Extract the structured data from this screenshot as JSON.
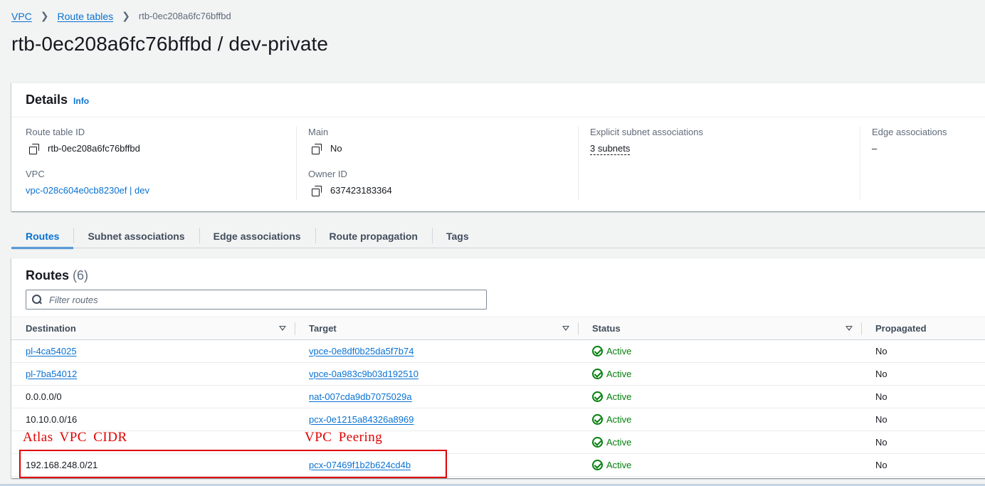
{
  "breadcrumb": {
    "items": [
      "VPC",
      "Route tables"
    ],
    "current": "rtb-0ec208a6fc76bffbd"
  },
  "page_title": "rtb-0ec208a6fc76bffbd / dev-private",
  "details": {
    "heading": "Details",
    "info": "Info",
    "route_table_id_label": "Route table ID",
    "route_table_id": "rtb-0ec208a6fc76bffbd",
    "vpc_label": "VPC",
    "vpc": "vpc-028c604e0cb8230ef | dev",
    "main_label": "Main",
    "main": "No",
    "owner_id_label": "Owner ID",
    "owner_id": "637423183364",
    "explicit_label": "Explicit subnet associations",
    "explicit": "3 subnets",
    "edge_label": "Edge associations",
    "edge": "–"
  },
  "tabs": [
    "Routes",
    "Subnet associations",
    "Edge associations",
    "Route propagation",
    "Tags"
  ],
  "routes": {
    "title": "Routes",
    "count": "(6)",
    "filter_placeholder": "Filter routes",
    "columns": [
      "Destination",
      "Target",
      "Status",
      "Propagated"
    ],
    "rows": [
      {
        "destination": "pl-4ca54025",
        "dest_link": true,
        "target": "vpce-0e8df0b25da5f7b74",
        "status": "Active",
        "propagated": "No"
      },
      {
        "destination": "pl-7ba54012",
        "dest_link": true,
        "target": "vpce-0a983c9b03d192510",
        "status": "Active",
        "propagated": "No"
      },
      {
        "destination": "0.0.0.0/0",
        "dest_link": false,
        "target": "nat-007cda9db7075029a",
        "status": "Active",
        "propagated": "No"
      },
      {
        "destination": "10.10.0.0/16",
        "dest_link": false,
        "target": "pcx-0e1215a84326a8969",
        "status": "Active",
        "propagated": "No"
      },
      {
        "destination": "",
        "dest_link": false,
        "target": "",
        "status": "Active",
        "propagated": "No"
      },
      {
        "destination": "192.168.248.0/21",
        "dest_link": false,
        "target": "pcx-07469f1b2b624cd4b",
        "status": "Active",
        "propagated": "No"
      }
    ]
  },
  "annotations": {
    "left": "Atlas VPC CIDR",
    "right": "VPC Peering"
  },
  "colors": {
    "link": "#0972d3",
    "success": "#037f0c",
    "annotation": "#e00000"
  }
}
